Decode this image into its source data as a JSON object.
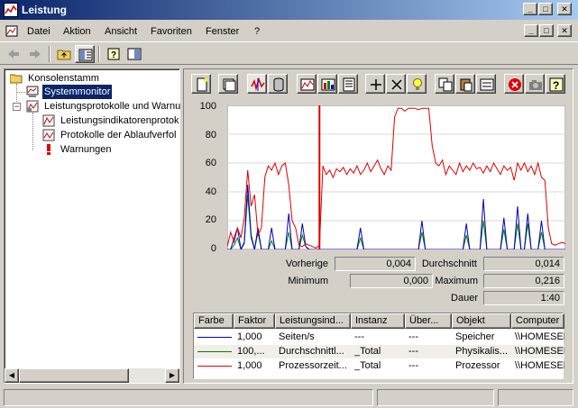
{
  "window": {
    "title": "Leistung",
    "min_glyph": "_",
    "max_glyph": "□",
    "close_glyph": "✕"
  },
  "menu": [
    {
      "label": "Datei"
    },
    {
      "label": "Aktion"
    },
    {
      "label": "Ansicht"
    },
    {
      "label": "Favoriten"
    },
    {
      "label": "Fenster"
    },
    {
      "label": "?"
    }
  ],
  "tree": {
    "root": "Konsolenstamm",
    "system_monitor": "Systemmonitor",
    "logs": "Leistungsprotokolle und Warnu",
    "counter_logs": "Leistungsindikatorenprotok",
    "trace_logs": "Protokolle der Ablaufverfol",
    "alerts": "Warnungen"
  },
  "stats": {
    "prev_label": "Vorherige",
    "prev_value": "0,004",
    "avg_label": "Durchschnitt",
    "avg_value": "0,014",
    "min_label": "Minimum",
    "min_value": "0,000",
    "max_label": "Maximum",
    "max_value": "0,216",
    "dur_label": "Dauer",
    "dur_value": "1:40"
  },
  "legend": {
    "columns": [
      "Farbe",
      "Faktor",
      "Leistungsind...",
      "Instanz",
      "Über...",
      "Objekt",
      "Computer"
    ],
    "rows": [
      {
        "color": "#0000c0",
        "factor": "1,000",
        "counter": "Seiten/s",
        "instance": "---",
        "parent": "---",
        "object": "Speicher",
        "computer": "\\\\HOMESER"
      },
      {
        "color": "#008000",
        "factor": "100,...",
        "counter": "Durchschnittl...",
        "instance": "_Total",
        "parent": "---",
        "object": "Physikalis...",
        "computer": "\\\\HOMESER"
      },
      {
        "color": "#e00000",
        "factor": "1,000",
        "counter": "Prozessorzeit...",
        "instance": "_Total",
        "parent": "---",
        "object": "Prozessor",
        "computer": "\\\\HOMESER"
      }
    ]
  },
  "chart_data": {
    "type": "line",
    "ylim": [
      0,
      100
    ],
    "yticks": [
      "100",
      "80",
      "60",
      "40",
      "20",
      "0"
    ],
    "grid": true,
    "x": [
      0,
      1,
      2,
      3,
      4,
      5,
      6,
      7,
      8,
      9,
      10,
      11,
      12,
      13,
      14,
      15,
      16,
      17,
      18,
      19,
      20,
      21,
      22,
      23,
      24,
      25,
      26,
      27,
      28,
      29,
      30,
      31,
      32,
      33,
      34,
      35,
      36,
      37,
      38,
      39,
      40,
      41,
      42,
      43,
      44,
      45,
      46,
      47,
      48,
      49,
      50,
      51,
      52,
      53,
      54,
      55,
      56,
      57,
      58,
      59,
      60,
      61,
      62,
      63,
      64,
      65,
      66,
      67,
      68,
      69,
      70,
      71,
      72,
      73,
      74,
      75,
      76,
      77,
      78,
      79,
      80,
      81,
      82,
      83,
      84,
      85,
      86,
      87,
      88,
      89,
      90,
      91,
      92,
      93,
      94,
      95,
      96,
      97,
      98,
      99
    ],
    "current_index": 27,
    "series": [
      {
        "color": "#e00000",
        "values": [
          2,
          12,
          5,
          15,
          8,
          22,
          55,
          30,
          38,
          10,
          15,
          50,
          58,
          55,
          60,
          52,
          58,
          60,
          45,
          20,
          15,
          3,
          2,
          4,
          3,
          2,
          1,
          3,
          58,
          52,
          55,
          50,
          56,
          54,
          57,
          52,
          56,
          53,
          58,
          52,
          55,
          60,
          54,
          58,
          62,
          56,
          52,
          58,
          55,
          92,
          98,
          98,
          96,
          98,
          98,
          98,
          97,
          98,
          98,
          98,
          72,
          60,
          58,
          62,
          52,
          58,
          55,
          52,
          60,
          54,
          58,
          55,
          60,
          56,
          57,
          53,
          58,
          54,
          60,
          56,
          52,
          58,
          55,
          57,
          48,
          60,
          55,
          60,
          54,
          58,
          52,
          60,
          50,
          48,
          15,
          4,
          3,
          4,
          5,
          4
        ]
      },
      {
        "color": "#0000c0",
        "values": [
          0,
          0,
          8,
          15,
          0,
          5,
          45,
          10,
          0,
          15,
          0,
          0,
          0,
          15,
          0,
          0,
          0,
          0,
          25,
          0,
          0,
          0,
          18,
          2,
          0,
          0,
          0,
          0,
          0,
          0,
          0,
          0,
          0,
          0,
          0,
          0,
          0,
          0,
          0,
          15,
          0,
          0,
          0,
          0,
          0,
          0,
          0,
          0,
          0,
          0,
          0,
          0,
          0,
          0,
          0,
          0,
          0,
          20,
          0,
          0,
          0,
          0,
          0,
          0,
          0,
          0,
          0,
          0,
          0,
          0,
          18,
          0,
          0,
          0,
          0,
          35,
          0,
          0,
          0,
          0,
          0,
          22,
          0,
          0,
          0,
          30,
          0,
          0,
          25,
          0,
          0,
          0,
          20,
          0,
          0,
          0,
          0,
          0,
          0,
          0
        ]
      },
      {
        "color": "#008000",
        "values": [
          0,
          0,
          3,
          8,
          0,
          4,
          38,
          8,
          0,
          12,
          0,
          0,
          0,
          6,
          0,
          0,
          0,
          0,
          12,
          0,
          0,
          0,
          10,
          2,
          0,
          0,
          0,
          0,
          0,
          0,
          0,
          0,
          0,
          0,
          0,
          0,
          0,
          0,
          0,
          8,
          0,
          0,
          0,
          0,
          0,
          0,
          0,
          0,
          0,
          0,
          0,
          0,
          0,
          0,
          0,
          0,
          0,
          12,
          0,
          0,
          0,
          0,
          0,
          0,
          0,
          0,
          0,
          0,
          0,
          0,
          10,
          0,
          0,
          0,
          0,
          20,
          0,
          0,
          0,
          0,
          0,
          14,
          0,
          0,
          0,
          18,
          0,
          0,
          18,
          0,
          0,
          0,
          12,
          0,
          0,
          0,
          0,
          0,
          0,
          0
        ]
      }
    ]
  }
}
